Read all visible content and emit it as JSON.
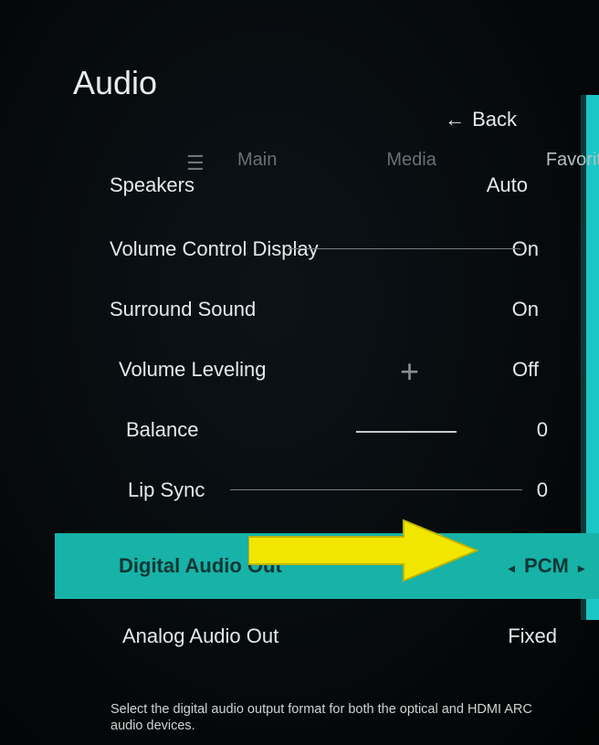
{
  "header": {
    "pageTitle": "Audio",
    "backLabel": "Back"
  },
  "tabs": {
    "main": "Main",
    "media": "Media",
    "favorites": "Favorites"
  },
  "settings": {
    "speakers": {
      "label": "Speakers",
      "value": "Auto"
    },
    "volDisplay": {
      "label": "Volume Control Display",
      "value": "On"
    },
    "surround": {
      "label": "Surround Sound",
      "value": "On"
    },
    "volLevel": {
      "label": "Volume Leveling",
      "value": "Off"
    },
    "balance": {
      "label": "Balance",
      "value": "0"
    },
    "lipSync": {
      "label": "Lip Sync",
      "value": "0"
    },
    "digitalOut": {
      "label": "Digital Audio Out",
      "value": "PCM"
    },
    "analogOut": {
      "label": "Analog Audio Out",
      "value": "Fixed"
    }
  },
  "helperText": "Select the digital audio output format for both the optical and HDMI ARC audio devices."
}
